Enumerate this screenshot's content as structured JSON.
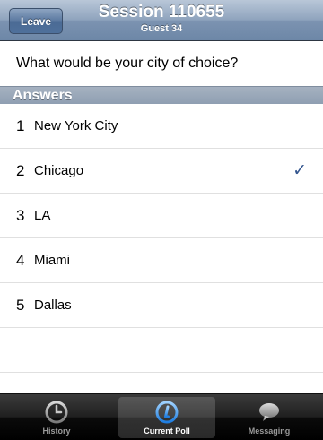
{
  "nav": {
    "leave_label": "Leave",
    "title": "Session 110655",
    "subtitle": "Guest 34"
  },
  "question": "What would be your city of choice?",
  "answers_header": "Answers",
  "answers": [
    {
      "num": "1",
      "text": "New York City",
      "selected": false
    },
    {
      "num": "2",
      "text": "Chicago",
      "selected": true
    },
    {
      "num": "3",
      "text": "LA",
      "selected": false
    },
    {
      "num": "4",
      "text": "Miami",
      "selected": false
    },
    {
      "num": "5",
      "text": "Dallas",
      "selected": false
    }
  ],
  "check_glyph": "✓",
  "tabs": [
    {
      "label": "History",
      "icon": "clock-icon",
      "active": false
    },
    {
      "label": "Current Poll",
      "icon": "info-icon",
      "active": true
    },
    {
      "label": "Messaging",
      "icon": "chat-bubble-icon",
      "active": false
    }
  ],
  "colors": {
    "nav_accent": "#6d87a7",
    "check": "#34568f",
    "tab_active_text": "#ffffff",
    "tab_inactive_text": "#9a9a9a"
  }
}
